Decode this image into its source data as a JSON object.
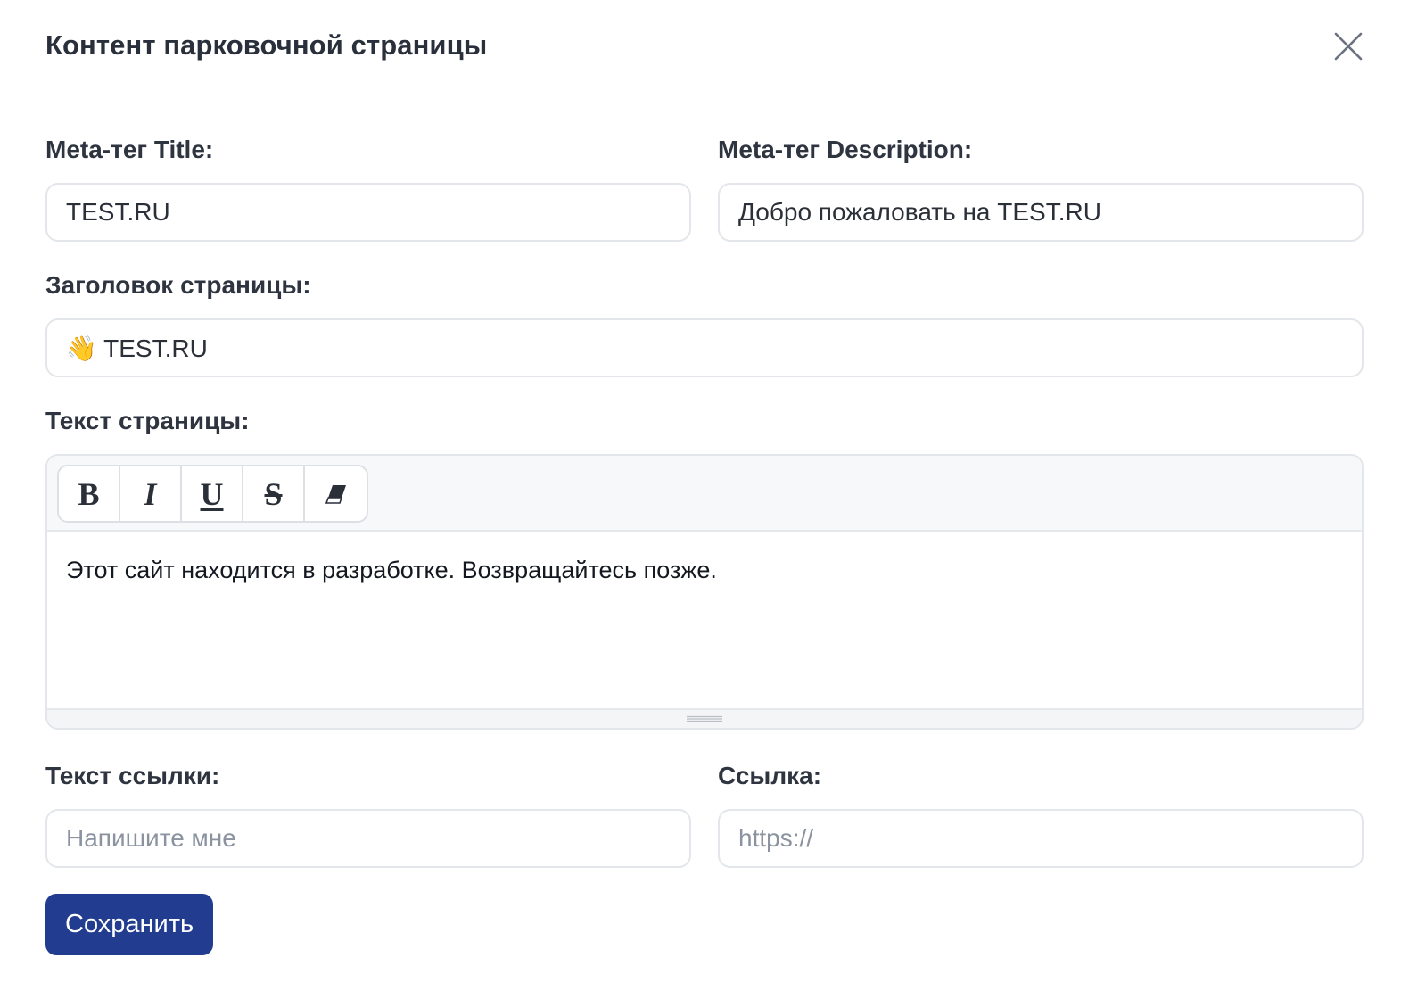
{
  "modal": {
    "title": "Контент парковочной страницы"
  },
  "icons": {
    "close": "close-icon",
    "bold": "bold-icon",
    "italic": "italic-icon",
    "underline": "underline-icon",
    "strikethrough": "strikethrough-icon",
    "eraser": "eraser-icon",
    "resize": "resize-handle-icon"
  },
  "fields": {
    "meta_title": {
      "label": "Meta-тег Title:",
      "value": "TEST.RU"
    },
    "meta_description": {
      "label": "Meta-тег Description:",
      "value": "Добро пожаловать на TEST.RU"
    },
    "page_heading": {
      "label": "Заголовок страницы:",
      "value": "👋 TEST.RU"
    },
    "page_text": {
      "label": "Текст страницы:",
      "content": "Этот сайт находится в разработке. Возвращайтесь позже."
    },
    "link_text": {
      "label": "Текст ссылки:",
      "value": "",
      "placeholder": "Напишите мне"
    },
    "link_url": {
      "label": "Ссылка:",
      "value": "",
      "placeholder": "https://"
    }
  },
  "toolbar": {
    "bold": "B",
    "italic": "I",
    "underline": "U",
    "strikethrough": "S"
  },
  "actions": {
    "save_label": "Сохранить"
  },
  "colors": {
    "primary": "#223c8f",
    "border": "#e3e6ea",
    "toolbar_bg": "#f7f8fa",
    "placeholder": "#8b93a0"
  }
}
